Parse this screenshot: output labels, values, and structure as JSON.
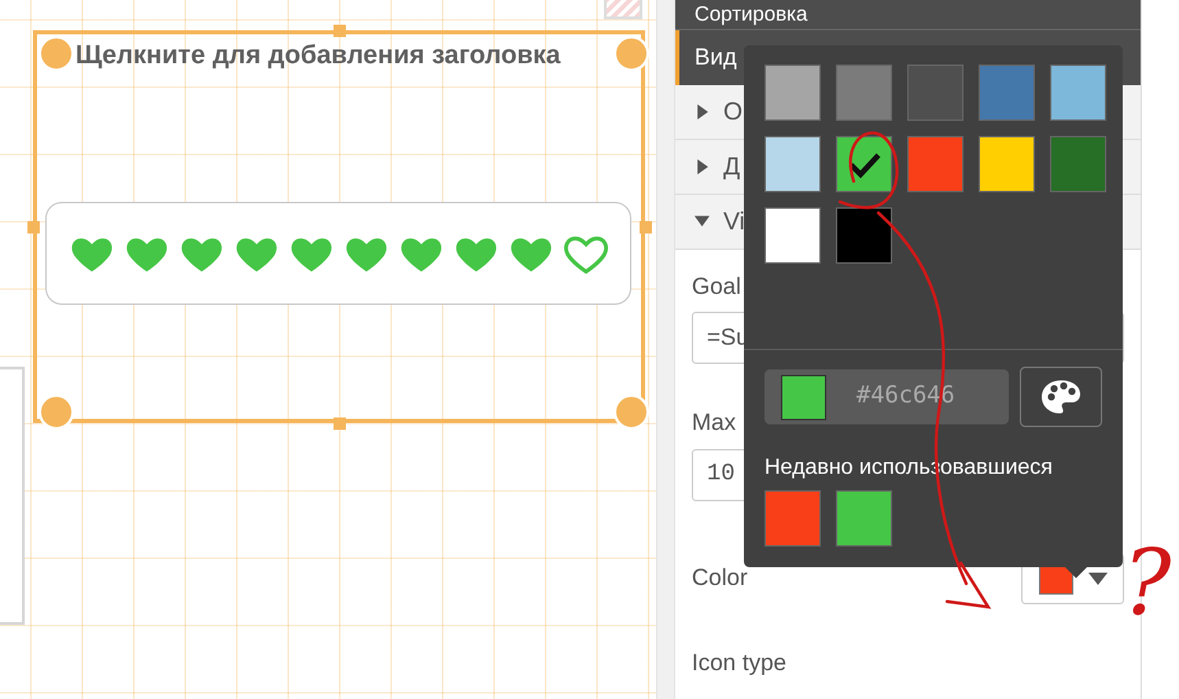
{
  "canvas": {
    "title": "Щелкните для добавления заголовка",
    "rating": {
      "stars": 9
    }
  },
  "panel": {
    "header": "Сортировка",
    "tabs": [
      {
        "label": "Вид",
        "selected": true
      }
    ],
    "sections": [
      {
        "label": "О",
        "expanded": false
      },
      {
        "label": "Д",
        "expanded": false
      },
      {
        "label": "Vi",
        "expanded": true
      }
    ],
    "fields": [
      {
        "label": "Goal",
        "value": "=Su",
        "kind": "text"
      },
      {
        "label": "Max",
        "value": "10",
        "kind": "mono"
      }
    ],
    "color_field": {
      "label": "Color",
      "color": "#f93f17"
    },
    "next_label": "Icon type"
  },
  "color_picker": {
    "palette": [
      {
        "color": "#a5a5a5",
        "selected": false
      },
      {
        "color": "#7b7b7b",
        "selected": false
      },
      {
        "color": "#4f4f4f",
        "selected": false
      },
      {
        "color": "#4477aa",
        "selected": false
      },
      {
        "color": "#7db8da",
        "selected": false
      },
      {
        "color": "#b6d7ea",
        "selected": false
      },
      {
        "color": "#46c646",
        "selected": true
      },
      {
        "color": "#f93f17",
        "selected": false
      },
      {
        "color": "#ffcf02",
        "selected": false
      },
      {
        "color": "#276e27",
        "selected": false
      },
      {
        "color": "#ffffff",
        "selected": false
      },
      {
        "color": "#000000",
        "selected": false
      }
    ],
    "hex": "#46c646",
    "recent_title": "Недавно использовавшиеся",
    "recent": [
      {
        "color": "#f93f17"
      },
      {
        "color": "#46c646"
      }
    ]
  },
  "annotations": {
    "question_mark": "?"
  }
}
